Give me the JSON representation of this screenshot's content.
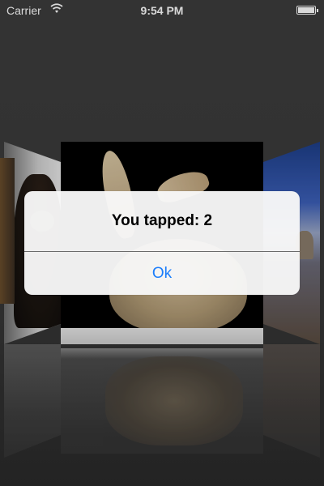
{
  "status_bar": {
    "carrier": "Carrier",
    "time": "9:54 PM"
  },
  "coverflow": {
    "items": [
      {
        "name": "ferret-image"
      },
      {
        "name": "rabbit-image"
      },
      {
        "name": "beach-rock-image"
      }
    ]
  },
  "alert": {
    "title": "You tapped: 2",
    "button_label": "Ok"
  },
  "colors": {
    "accent": "#1a7dfb",
    "background": "#3a3a3a"
  }
}
